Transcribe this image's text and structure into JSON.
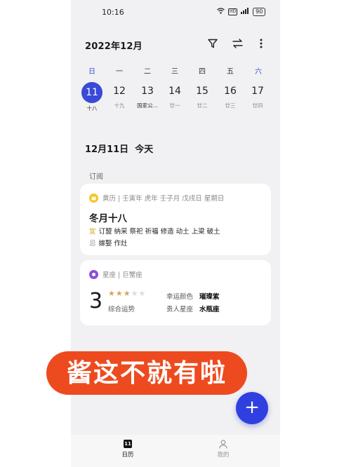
{
  "status_bar": {
    "time": "10:16",
    "battery": "90"
  },
  "header": {
    "month": "2022年12月"
  },
  "week": {
    "weekdays": [
      "日",
      "一",
      "二",
      "三",
      "四",
      "五",
      "六"
    ],
    "days": [
      {
        "num": "11",
        "sub": "十八"
      },
      {
        "num": "12",
        "sub": "十九"
      },
      {
        "num": "13",
        "sub": "国家公..."
      },
      {
        "num": "14",
        "sub": "廿一"
      },
      {
        "num": "15",
        "sub": "廿二"
      },
      {
        "num": "16",
        "sub": "廿三"
      },
      {
        "num": "17",
        "sub": "廿四"
      }
    ]
  },
  "selected_date": "12月11日  今天",
  "section_label": "订阅",
  "almanac": {
    "header": "黄历 | 壬寅年 虎年 壬子月 戊戌日 星期日",
    "lunar_date": "冬月十八",
    "yi_tag": "宜",
    "yi": "订盟 纳采 祭祀 祈福 修造 动土 上梁 破土",
    "ji_tag": "忌",
    "ji": "嫁娶 作灶"
  },
  "horoscope": {
    "header": "星座 | 巨蟹座",
    "score": "3",
    "rating": 3,
    "rating_max": 5,
    "score_label": "综合运势",
    "lucky_color_key": "幸运颜色",
    "lucky_color_val": "璀璨紫",
    "noble_sign_key": "贵人星座",
    "noble_sign_val": "水瓶座"
  },
  "fab_label": "+",
  "bottom_nav": {
    "calendar_icon_text": "11",
    "calendar_label": "日历",
    "mine_label": "我的"
  },
  "banner_text": "酱这不就有啦",
  "colors": {
    "accent": "#3a49d8",
    "fab": "#3040e0",
    "banner": "#ee4a1f",
    "almanac_badge": "#f4c623",
    "horoscope_badge": "#8a4fe0",
    "star_on": "#d4a65a"
  }
}
